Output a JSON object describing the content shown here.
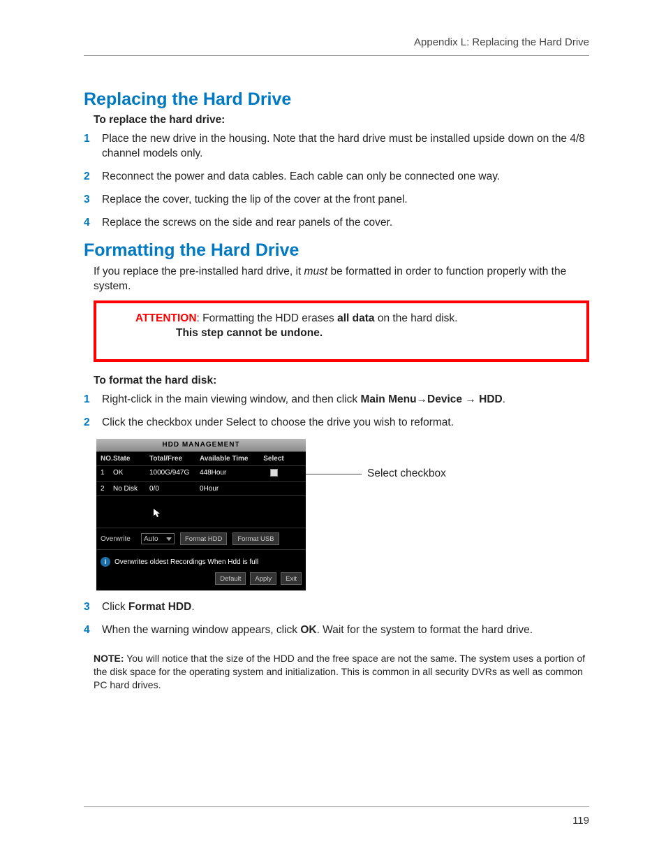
{
  "header": "Appendix L: Replacing the Hard Drive",
  "page_number": "119",
  "section1": {
    "title": "Replacing the Hard Drive",
    "intro": "To replace the hard drive:",
    "steps": [
      "Place the new drive in the housing. Note that the hard drive must be installed upside down on the 4/8 channel models only.",
      "Reconnect the power and data cables. Each cable can only be connected one way.",
      "Replace the cover, tucking the lip of the cover at the front panel.",
      "Replace the screws on the side and rear panels of the cover."
    ]
  },
  "section2": {
    "title": "Formatting the Hard Drive",
    "intro_plain_a": "If you replace the pre-installed hard drive, it ",
    "intro_italic": "must",
    "intro_plain_b": " be formatted in order to function properly with the system.",
    "attention": {
      "label": "ATTENTION",
      "text_a": ": Formatting the HDD erases ",
      "bold": "all data",
      "text_b": " on the hard disk.",
      "line2": "This step cannot be undone."
    },
    "format_intro": "To format the hard disk:",
    "steps12": {
      "s1_a": "Right-click in the main viewing window, and then click ",
      "s1_b1": "Main Menu",
      "s1_b2": "Device",
      "s1_b3": "HDD",
      "s2": "Click the checkbox under Select to choose the drive you wish to reformat."
    },
    "steps34": {
      "s3_a": "Click ",
      "s3_b": "Format HDD",
      "s4_a": "When the warning window appears, click ",
      "s4_b": "OK",
      "s4_c": ". Wait for the system to format the hard drive."
    },
    "callout": "Select checkbox"
  },
  "shot": {
    "title": "HDD  MANAGEMENT",
    "head": {
      "no": "NO.",
      "state": "State",
      "tf": "Total/Free",
      "at": "Available Time",
      "sel": "Select"
    },
    "rows": [
      {
        "no": "1",
        "state": "OK",
        "tf": "1000G/947G",
        "at": "448Hour"
      },
      {
        "no": "2",
        "state": "No Disk",
        "tf": "0/0",
        "at": "0Hour"
      }
    ],
    "overwrite_label": "Overwrite",
    "overwrite_value": "Auto",
    "btn_format_hdd": "Format HDD",
    "btn_format_usb": "Format USB",
    "info_text": "Overwrites oldest Recordings When Hdd is full",
    "btn_default": "Default",
    "btn_apply": "Apply",
    "btn_exit": "Exit"
  },
  "note": {
    "label": "NOTE:",
    "text": " You will notice that the size of the HDD and the free space are not the same. The system uses a portion of the disk space for the operating system and initialization. This is common in all security DVRs as well as common PC hard drives."
  }
}
